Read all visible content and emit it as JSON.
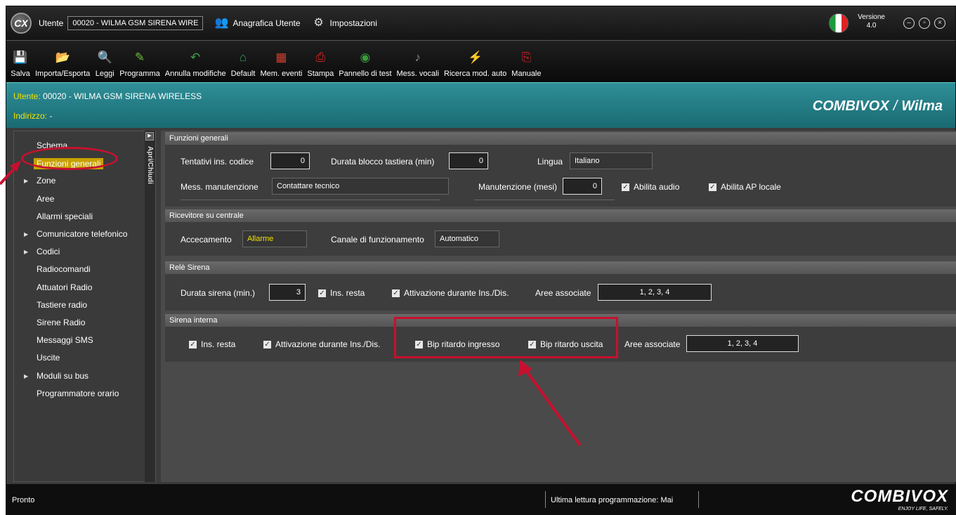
{
  "titlebar": {
    "logo_text": "CX",
    "user_label": "Utente",
    "user_value": "00020 - WILMA GSM SIRENA WIRE",
    "anagrafica": "Anagrafica Utente",
    "impostazioni": "Impostazioni",
    "version_label": "Versione",
    "version_value": "4.0"
  },
  "toolbar": [
    {
      "label": "Salva",
      "icon": "save-icon",
      "glyph": "💾",
      "color": "#5a7fd8"
    },
    {
      "label": "Importa/Esporta",
      "icon": "import-export-icon",
      "glyph": "📂",
      "color": "#e0a030"
    },
    {
      "label": "Leggi",
      "icon": "read-icon",
      "glyph": "🔍",
      "color": "#4a90d0"
    },
    {
      "label": "Programma",
      "icon": "program-icon",
      "glyph": "✎",
      "color": "#6bbf3a"
    },
    {
      "label": "Annulla modifiche",
      "icon": "undo-icon",
      "glyph": "↶",
      "color": "#3aa04a"
    },
    {
      "label": "Default",
      "icon": "home-icon",
      "glyph": "⌂",
      "color": "#2f9f4f"
    },
    {
      "label": "Mem. eventi",
      "icon": "calendar-icon",
      "glyph": "▦",
      "color": "#d04030"
    },
    {
      "label": "Stampa",
      "icon": "pdf-print-icon",
      "glyph": "⎙",
      "color": "#cc2222"
    },
    {
      "label": "Pannello di test",
      "icon": "globe-icon",
      "glyph": "◉",
      "color": "#3a9a3a"
    },
    {
      "label": "Mess. vocali",
      "icon": "speaker-icon",
      "glyph": "♪",
      "color": "#888888"
    },
    {
      "label": "Ricerca mod. auto",
      "icon": "plug-play-icon",
      "glyph": "⚡",
      "color": "#d6b400"
    },
    {
      "label": "Manuale",
      "icon": "pdf-manual-icon",
      "glyph": "⎘",
      "color": "#cc2222"
    }
  ],
  "banner": {
    "user_prefix": "Utente:",
    "user_value": "00020 - WILMA GSM SIRENA WIRELESS",
    "address_prefix": "Indirizzo:",
    "address_value": "-",
    "brand_left": "COMBIVOX",
    "brand_sep": "/",
    "brand_right": "Wilma"
  },
  "sidebar": {
    "collapse_label": "Apri/Chiudi",
    "items": [
      {
        "label": "Schema",
        "arrow": false,
        "selected": false
      },
      {
        "label": "Funzioni generali",
        "arrow": false,
        "selected": true
      },
      {
        "label": "Zone",
        "arrow": true,
        "selected": false
      },
      {
        "label": "Aree",
        "arrow": false,
        "selected": false
      },
      {
        "label": "Allarmi speciali",
        "arrow": false,
        "selected": false
      },
      {
        "label": "Comunicatore telefonico",
        "arrow": true,
        "selected": false
      },
      {
        "label": "Codici",
        "arrow": true,
        "selected": false
      },
      {
        "label": "Radiocomandi",
        "arrow": false,
        "selected": false
      },
      {
        "label": "Attuatori Radio",
        "arrow": false,
        "selected": false
      },
      {
        "label": "Tastiere radio",
        "arrow": false,
        "selected": false
      },
      {
        "label": "Sirene Radio",
        "arrow": false,
        "selected": false
      },
      {
        "label": "Messaggi SMS",
        "arrow": false,
        "selected": false
      },
      {
        "label": "Uscite",
        "arrow": false,
        "selected": false
      },
      {
        "label": "Moduli su bus",
        "arrow": true,
        "selected": false
      },
      {
        "label": "Programmatore orario",
        "arrow": false,
        "selected": false
      }
    ]
  },
  "funzioni_generali": {
    "title": "Funzioni generali",
    "tentativi_label": "Tentativi ins. codice",
    "tentativi_value": "0",
    "durata_blocco_label": "Durata blocco tastiera (min)",
    "durata_blocco_value": "0",
    "lingua_label": "Lingua",
    "lingua_value": "Italiano",
    "mess_manut_label": "Mess. manutenzione",
    "mess_manut_value": "Contattare tecnico",
    "manut_mesi_label": "Manutenzione (mesi)",
    "manut_mesi_value": "0",
    "abilita_audio": "Abilita audio",
    "abilita_audio_checked": true,
    "abilita_ap": "Abilita AP locale",
    "abilita_ap_checked": true
  },
  "ricevitore": {
    "title": "Ricevitore su centrale",
    "accecamento_label": "Accecamento",
    "accecamento_value": "Allarme",
    "canale_label": "Canale di funzionamento",
    "canale_value": "Automatico"
  },
  "rele_sirena": {
    "title": "Relè Sirena",
    "durata_label": "Durata sirena (min.)",
    "durata_value": "3",
    "ins_resta": "Ins. resta",
    "attivazione": "Attivazione durante Ins./Dis.",
    "aree_label": "Aree associate",
    "aree_value": "1, 2, 3, 4"
  },
  "sirena_interna": {
    "title": "Sirena interna",
    "ins_resta": "Ins. resta",
    "attivazione": "Attivazione durante Ins./Dis.",
    "bip_ingresso": "Bip ritardo ingresso",
    "bip_uscita": "Bip ritardo uscita",
    "aree_label": "Aree associate",
    "aree_value": "1, 2, 3, 4"
  },
  "statusbar": {
    "status": "Pronto",
    "last_read": "Ultima lettura programmazione: Mai",
    "brand": "COMBIVOX",
    "tagline": "ENJOY LIFE, SAFELY."
  },
  "checkmark": "✓",
  "colors": {
    "accent_yellow": "#f2e300",
    "banner_teal": "#2f8f98",
    "selected_item": "#c7a100",
    "annotation_red": "#c8102e"
  }
}
